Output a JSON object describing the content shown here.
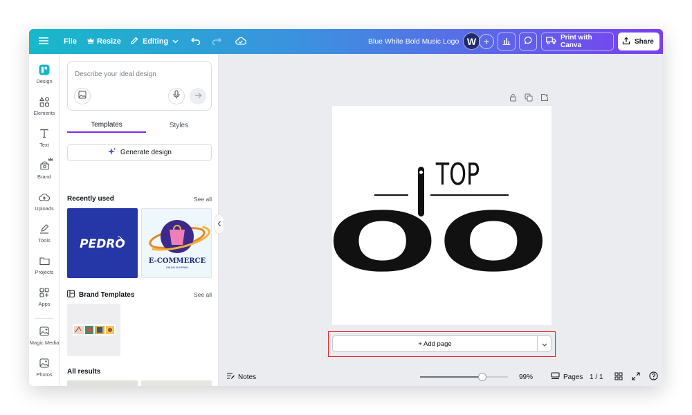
{
  "topbar": {
    "file_label": "File",
    "resize_label": "Resize",
    "editing_label": "Editing",
    "doc_title": "Blue White Bold Music Logo",
    "avatar_initial": "W",
    "add_label": "+",
    "print_label": "Print with Canva",
    "share_label": "Share"
  },
  "rail": {
    "items": [
      {
        "label": "Design",
        "icon": "design-icon"
      },
      {
        "label": "Elements",
        "icon": "elements-icon"
      },
      {
        "label": "Text",
        "icon": "text-icon"
      },
      {
        "label": "Brand",
        "icon": "brand-icon"
      },
      {
        "label": "Uploads",
        "icon": "uploads-icon"
      },
      {
        "label": "Tools",
        "icon": "tools-icon"
      },
      {
        "label": "Projects",
        "icon": "projects-icon"
      },
      {
        "label": "Apps",
        "icon": "apps-icon"
      },
      {
        "label": "Magic Media",
        "icon": "magic-media-icon"
      },
      {
        "label": "Photos",
        "icon": "photos-icon"
      }
    ]
  },
  "panel": {
    "prompt_placeholder": "Describe your ideal design",
    "tabs": [
      "Templates",
      "Styles"
    ],
    "generate_label": "Generate design",
    "recently_used": {
      "title": "Recently used",
      "link": "See all"
    },
    "brand_templates": {
      "title": "Brand Templates",
      "link": "See all"
    },
    "all_results": {
      "title": "All results"
    },
    "thumb_pedro_text": "PEDRO",
    "thumb_ecom_title": "E-COMMERCE",
    "thumb_ecom_sub": "ONLINE SHOPPING"
  },
  "canvas": {
    "logo_top": "TOP",
    "logo_main": "COOK",
    "add_page_label": "+ Add page"
  },
  "footer": {
    "notes_label": "Notes",
    "zoom_value": "99%",
    "zoom_fraction": 0.71,
    "pages_label": "Pages",
    "page_count": "1 / 1"
  },
  "colors": {
    "accent": "#7d2ae8",
    "highlight_border": "#e8232a",
    "logo": "#111111"
  }
}
